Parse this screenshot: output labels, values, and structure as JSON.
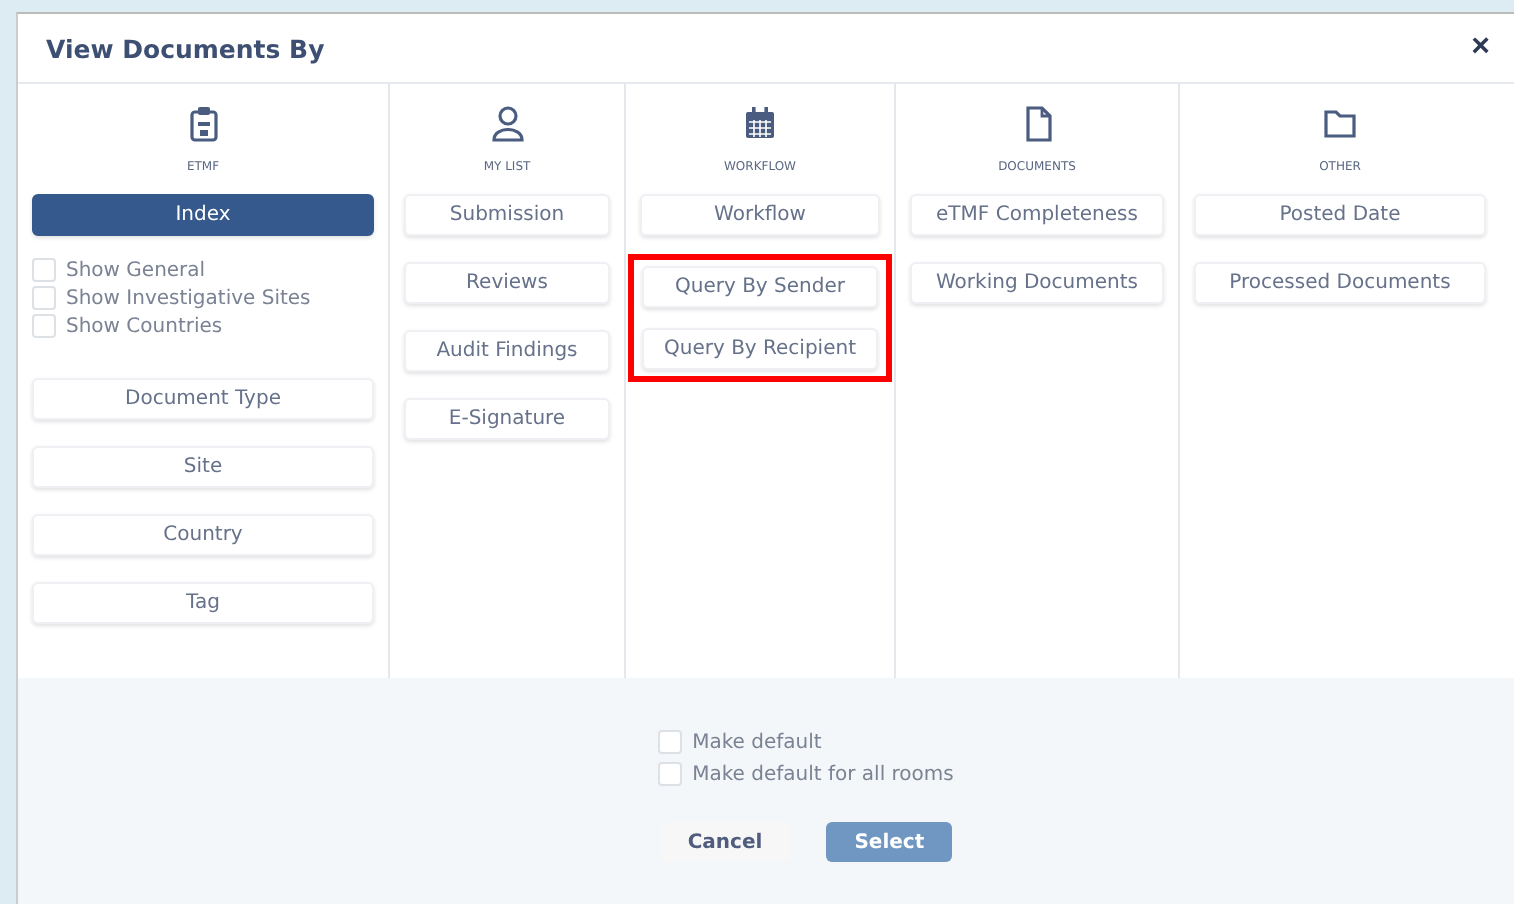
{
  "dialog": {
    "title": "View Documents By",
    "close": "×"
  },
  "columns": [
    {
      "label": "ETMF",
      "items": [
        {
          "kind": "option",
          "label": "Index",
          "selected": true,
          "highlighted": false
        },
        {
          "kind": "checkbox",
          "label": "Show General",
          "checked": false
        },
        {
          "kind": "checkbox",
          "label": "Show Investigative Sites",
          "checked": false
        },
        {
          "kind": "checkbox",
          "label": "Show Countries",
          "checked": false
        },
        {
          "kind": "option",
          "label": "Document Type",
          "selected": false,
          "highlighted": false
        },
        {
          "kind": "option",
          "label": "Site",
          "selected": false,
          "highlighted": false
        },
        {
          "kind": "option",
          "label": "Country",
          "selected": false,
          "highlighted": false
        },
        {
          "kind": "option",
          "label": "Tag",
          "selected": false,
          "highlighted": false
        }
      ]
    },
    {
      "label": "MY LIST",
      "items": [
        {
          "kind": "option",
          "label": "Submission",
          "selected": false,
          "highlighted": false
        },
        {
          "kind": "option",
          "label": "Reviews",
          "selected": false,
          "highlighted": false
        },
        {
          "kind": "option",
          "label": "Audit Findings",
          "selected": false,
          "highlighted": false
        },
        {
          "kind": "option",
          "label": "E-Signature",
          "selected": false,
          "highlighted": false
        }
      ]
    },
    {
      "label": "WORKFLOW",
      "items": [
        {
          "kind": "option",
          "label": "Workflow",
          "selected": false,
          "highlighted": false
        },
        {
          "kind": "option",
          "label": "Query By Sender",
          "selected": false,
          "highlighted": true
        },
        {
          "kind": "option",
          "label": "Query By Recipient",
          "selected": false,
          "highlighted": true
        }
      ]
    },
    {
      "label": "DOCUMENTS",
      "items": [
        {
          "kind": "option",
          "label": "eTMF Completeness",
          "selected": false,
          "highlighted": false
        },
        {
          "kind": "option",
          "label": "Working Documents",
          "selected": false,
          "highlighted": false
        }
      ]
    },
    {
      "label": "OTHER",
      "items": [
        {
          "kind": "option",
          "label": "Posted Date",
          "selected": false,
          "highlighted": false
        },
        {
          "kind": "option",
          "label": "Processed Documents",
          "selected": false,
          "highlighted": false
        }
      ]
    }
  ],
  "footer": {
    "checkboxes": [
      {
        "label": "Make default",
        "checked": false
      },
      {
        "label": "Make default for all rooms",
        "checked": false
      }
    ],
    "buttons": [
      {
        "label": "Cancel",
        "kind": "secondary"
      },
      {
        "label": "Select",
        "kind": "primary"
      }
    ]
  }
}
